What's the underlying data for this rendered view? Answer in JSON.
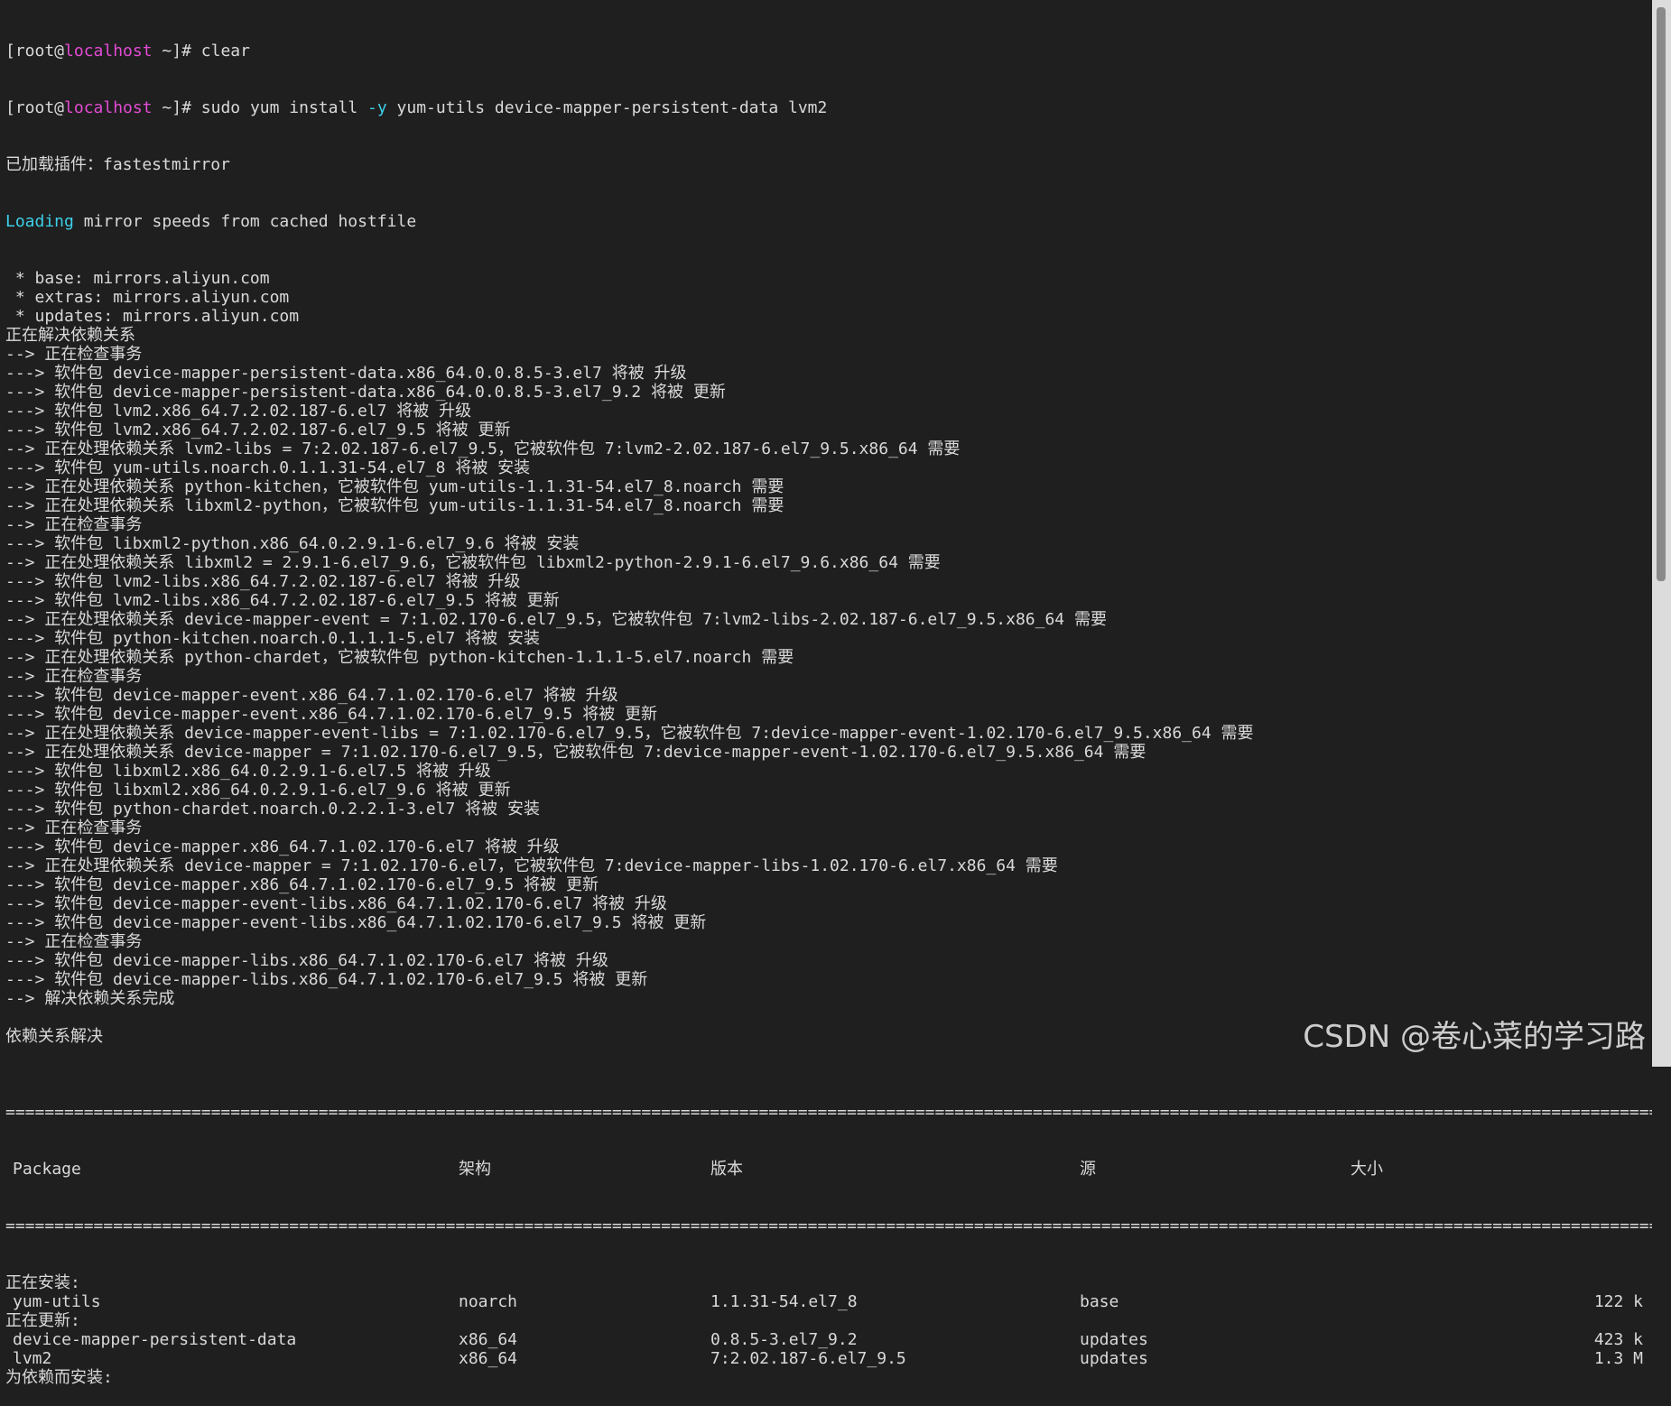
{
  "colors": {
    "background": "#1f1f1f",
    "text": "#d9d9d9",
    "host": "#e24bd3",
    "accent": "#3cd0e8"
  },
  "prompts": [
    {
      "prefix": "[root@",
      "host": "localhost",
      "suffix": " ~]# ",
      "cmd_a": "clear",
      "flag": "",
      "cmd_b": ""
    },
    {
      "prefix": "[root@",
      "host": "localhost",
      "suffix": " ~]# ",
      "cmd_a": "sudo yum install ",
      "flag": "-y",
      "cmd_b": " yum-utils device-mapper-persistent-data lvm2"
    }
  ],
  "output": {
    "plugins": "已加载插件：fastestmirror",
    "loading_word": "Loading",
    "loading_rest": " mirror speeds from cached hostfile",
    "lines": [
      " * base: mirrors.aliyun.com",
      " * extras: mirrors.aliyun.com",
      " * updates: mirrors.aliyun.com",
      "正在解决依赖关系",
      "--> 正在检查事务",
      "---> 软件包 device-mapper-persistent-data.x86_64.0.0.8.5-3.el7 将被 升级",
      "---> 软件包 device-mapper-persistent-data.x86_64.0.0.8.5-3.el7_9.2 将被 更新",
      "---> 软件包 lvm2.x86_64.7.2.02.187-6.el7 将被 升级",
      "---> 软件包 lvm2.x86_64.7.2.02.187-6.el7_9.5 将被 更新",
      "--> 正在处理依赖关系 lvm2-libs = 7:2.02.187-6.el7_9.5，它被软件包 7:lvm2-2.02.187-6.el7_9.5.x86_64 需要",
      "---> 软件包 yum-utils.noarch.0.1.1.31-54.el7_8 将被 安装",
      "--> 正在处理依赖关系 python-kitchen，它被软件包 yum-utils-1.1.31-54.el7_8.noarch 需要",
      "--> 正在处理依赖关系 libxml2-python，它被软件包 yum-utils-1.1.31-54.el7_8.noarch 需要",
      "--> 正在检查事务",
      "---> 软件包 libxml2-python.x86_64.0.2.9.1-6.el7_9.6 将被 安装",
      "--> 正在处理依赖关系 libxml2 = 2.9.1-6.el7_9.6，它被软件包 libxml2-python-2.9.1-6.el7_9.6.x86_64 需要",
      "---> 软件包 lvm2-libs.x86_64.7.2.02.187-6.el7 将被 升级",
      "---> 软件包 lvm2-libs.x86_64.7.2.02.187-6.el7_9.5 将被 更新",
      "--> 正在处理依赖关系 device-mapper-event = 7:1.02.170-6.el7_9.5，它被软件包 7:lvm2-libs-2.02.187-6.el7_9.5.x86_64 需要",
      "---> 软件包 python-kitchen.noarch.0.1.1.1-5.el7 将被 安装",
      "--> 正在处理依赖关系 python-chardet，它被软件包 python-kitchen-1.1.1-5.el7.noarch 需要",
      "--> 正在检查事务",
      "---> 软件包 device-mapper-event.x86_64.7.1.02.170-6.el7 将被 升级",
      "---> 软件包 device-mapper-event.x86_64.7.1.02.170-6.el7_9.5 将被 更新",
      "--> 正在处理依赖关系 device-mapper-event-libs = 7:1.02.170-6.el7_9.5，它被软件包 7:device-mapper-event-1.02.170-6.el7_9.5.x86_64 需要",
      "--> 正在处理依赖关系 device-mapper = 7:1.02.170-6.el7_9.5，它被软件包 7:device-mapper-event-1.02.170-6.el7_9.5.x86_64 需要",
      "---> 软件包 libxml2.x86_64.0.2.9.1-6.el7.5 将被 升级",
      "---> 软件包 libxml2.x86_64.0.2.9.1-6.el7_9.6 将被 更新",
      "---> 软件包 python-chardet.noarch.0.2.2.1-3.el7 将被 安装",
      "--> 正在检查事务",
      "---> 软件包 device-mapper.x86_64.7.1.02.170-6.el7 将被 升级",
      "--> 正在处理依赖关系 device-mapper = 7:1.02.170-6.el7，它被软件包 7:device-mapper-libs-1.02.170-6.el7.x86_64 需要",
      "---> 软件包 device-mapper.x86_64.7.1.02.170-6.el7_9.5 将被 更新",
      "---> 软件包 device-mapper-event-libs.x86_64.7.1.02.170-6.el7 将被 升级",
      "---> 软件包 device-mapper-event-libs.x86_64.7.1.02.170-6.el7_9.5 将被 更新",
      "--> 正在检查事务",
      "---> 软件包 device-mapper-libs.x86_64.7.1.02.170-6.el7 将被 升级",
      "---> 软件包 device-mapper-libs.x86_64.7.1.02.170-6.el7_9.5 将被 更新",
      "--> 解决依赖关系完成",
      "",
      "依赖关系解决",
      ""
    ],
    "separator": "==================================================================================================================================================================================================="
  },
  "table": {
    "headers": {
      "package": "Package",
      "arch": "架构",
      "version": "版本",
      "repo": "源",
      "size": "大小"
    },
    "sections": [
      {
        "title": "正在安装:",
        "rows": [
          {
            "name": "yum-utils",
            "arch": "noarch",
            "version": "1.1.31-54.el7_8",
            "repo": "base",
            "size": "122 k"
          }
        ]
      },
      {
        "title": "正在更新:",
        "rows": [
          {
            "name": "device-mapper-persistent-data",
            "arch": "x86_64",
            "version": "0.8.5-3.el7_9.2",
            "repo": "updates",
            "size": "423 k"
          },
          {
            "name": "lvm2",
            "arch": "x86_64",
            "version": "7:2.02.187-6.el7_9.5",
            "repo": "updates",
            "size": "1.3 M"
          }
        ]
      },
      {
        "title": "为依赖而安装:",
        "rows": []
      }
    ]
  },
  "watermark": "CSDN @卷心菜的学习路"
}
